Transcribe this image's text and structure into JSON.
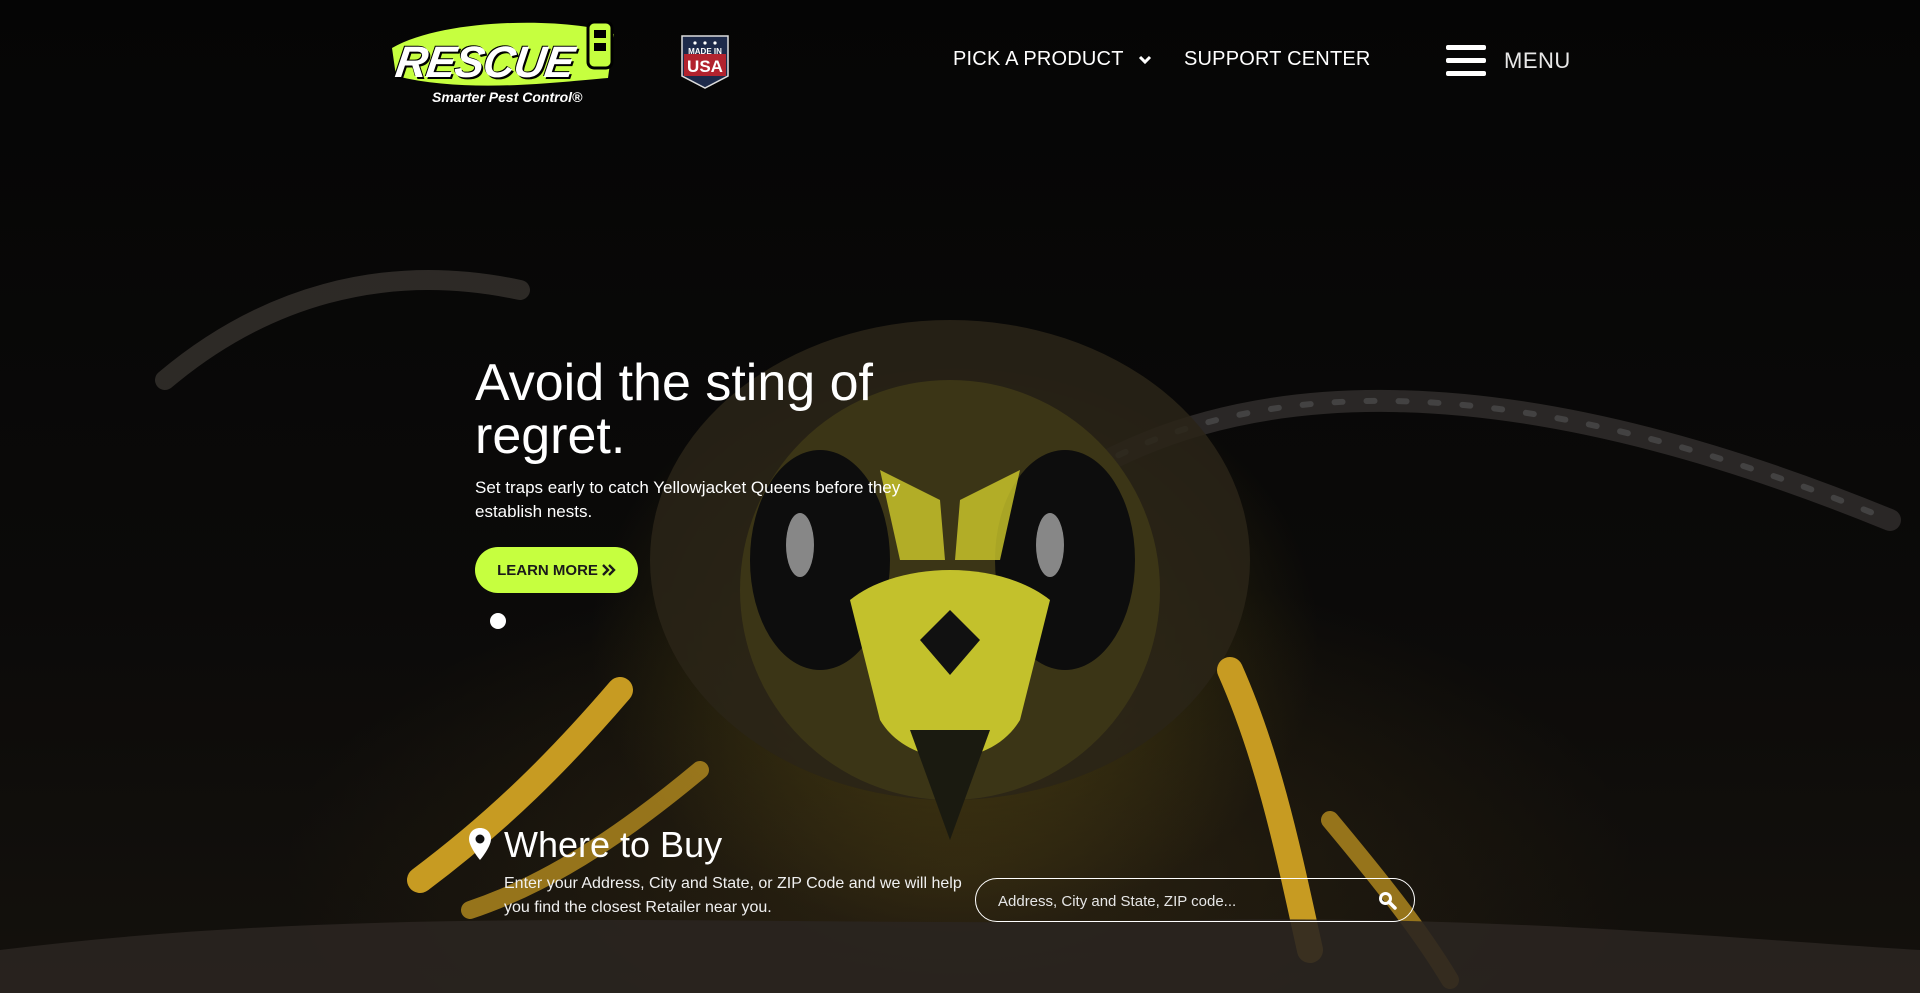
{
  "header": {
    "logo": {
      "wordmark": "RESCUE",
      "tagline": "Smarter Pest Control®"
    },
    "badge": {
      "line1": "MADE IN",
      "line2": "USA",
      "icon": "made-in-usa-badge"
    },
    "nav": {
      "pick_product": "PICK A PRODUCT",
      "support": "SUPPORT CENTER",
      "menu": "MENU"
    }
  },
  "hero": {
    "title": "Avoid the sting of regret.",
    "subtitle": "Set traps early to catch Yellowjacket Queens before they establish nests.",
    "cta": "LEARN MORE",
    "cta_icon": "double-chevron-right"
  },
  "where_to_buy": {
    "title": "Where to Buy",
    "description": "Enter your Address, City and State, or ZIP Code and we will help you find the closest Retailer near you.",
    "search_placeholder": "Address, City and State, ZIP code...",
    "icons": [
      "location-pin-icon",
      "search-icon"
    ]
  },
  "colors": {
    "accent": "#c6ff3f",
    "background": "#070707",
    "text": "#ffffff"
  }
}
